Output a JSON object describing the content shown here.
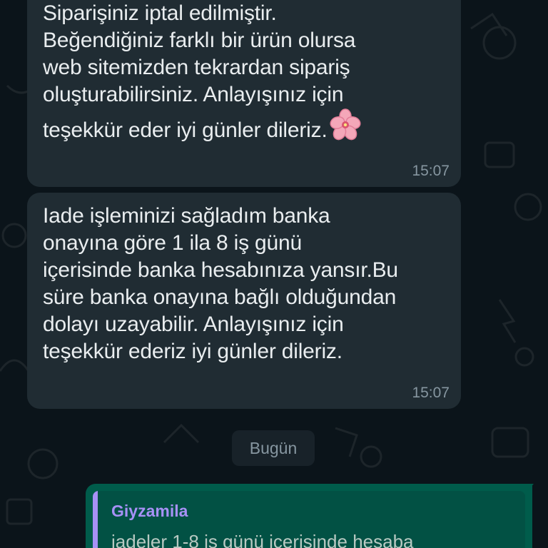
{
  "messages": [
    {
      "text": "Siparişiniz iptal edilmiştir.\nBeğendiğiniz farklı bir ürün olursa\nweb sitemizden tekrardan sipariş\noluşturabilirsiniz. Anlayışınız için\nteşekkür eder iyi günler dileriz.",
      "emoji": "cherry-blossom",
      "time": "15:07"
    },
    {
      "text": "Iade işleminizi sağladım banka\nonayına göre 1 ila 8 iş günü\niçerisinde banka hesabınıza yansır.Bu\nsüre banka onayına bağlı olduğundan\ndolayı uzayabilir. Anlayışınız için\nteşekkür ederiz iyi günler dileriz.",
      "time": "15:07"
    }
  ],
  "date_divider": "Bugün",
  "outgoing": {
    "quote_author": "Giyzamila",
    "quote_text": "iadeler 1-8 iş günü içerisinde hesaba"
  },
  "colors": {
    "background": "#0b141a",
    "incoming_bubble": "#202c33",
    "outgoing_bubble": "#005c4b",
    "quote_accent": "#a791f6"
  }
}
